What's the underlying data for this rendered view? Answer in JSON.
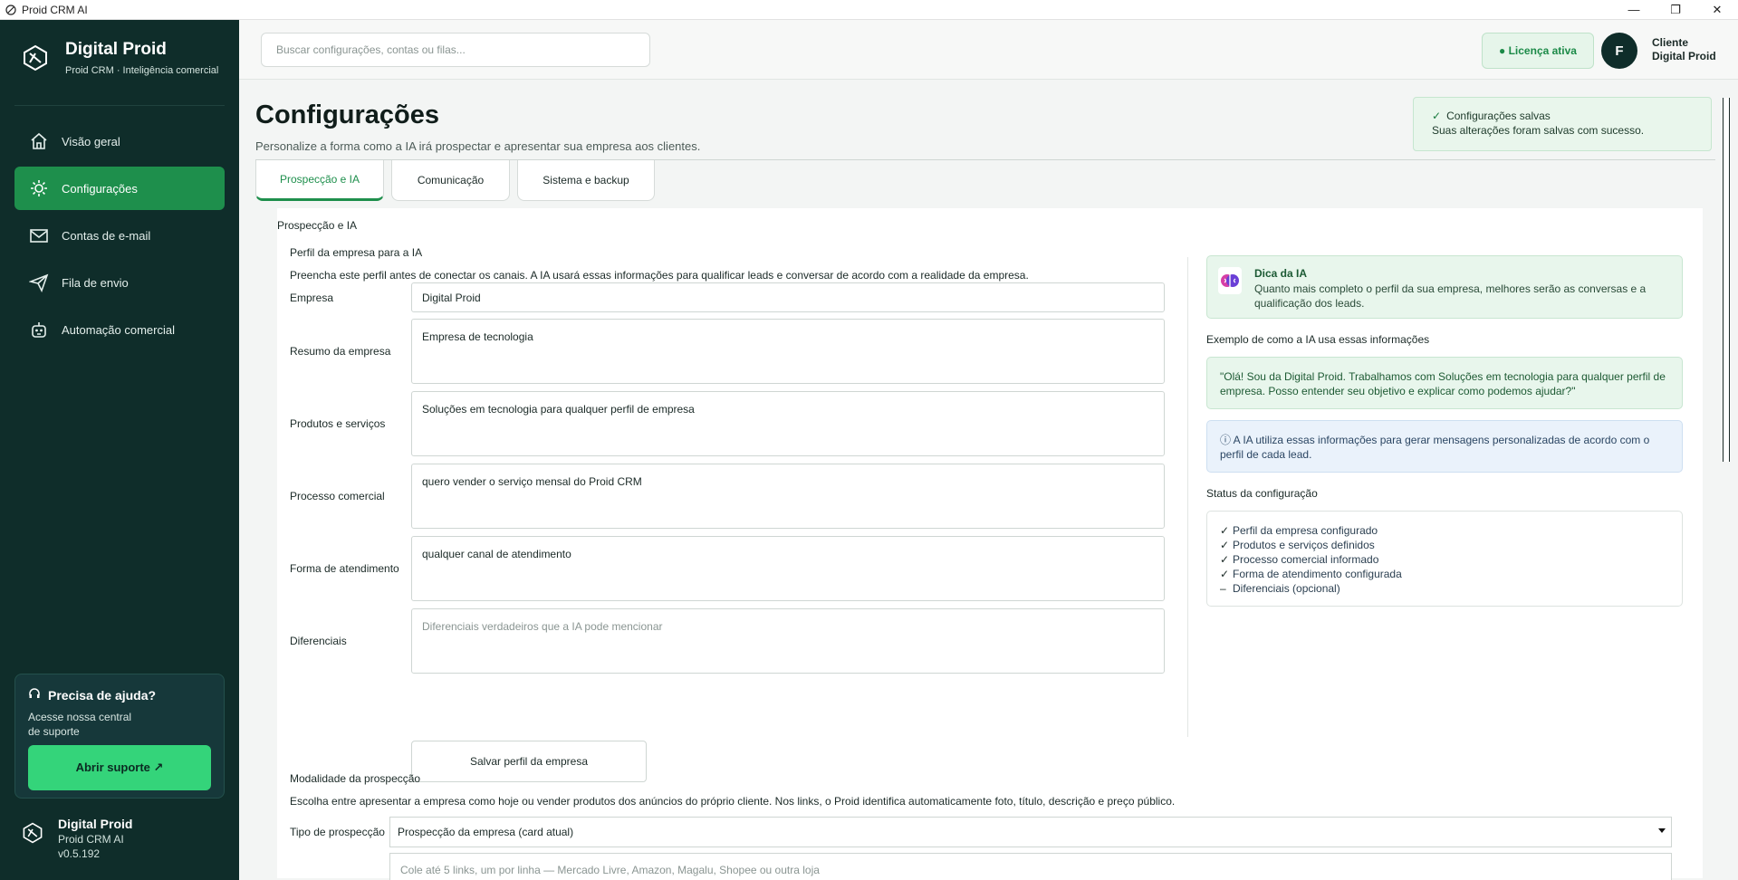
{
  "window": {
    "title": "Proid CRM AI",
    "controls": [
      "—",
      "❐",
      "✕"
    ]
  },
  "brand": {
    "name": "Digital Proid",
    "tagline": "Proid CRM · Inteligência comercial"
  },
  "nav": [
    {
      "label": "Visão geral",
      "icon": "home-icon"
    },
    {
      "label": "Configurações",
      "icon": "gear-icon",
      "active": true
    },
    {
      "label": "Contas de e-mail",
      "icon": "mail-icon"
    },
    {
      "label": "Fila de envio",
      "icon": "send-icon"
    },
    {
      "label": "Automação comercial",
      "icon": "robot-icon"
    }
  ],
  "help": {
    "title": "Precisa de ajuda?",
    "text": "Acesse nossa central de suporte",
    "button": "Abrir suporte ↗"
  },
  "footer": {
    "name": "Digital Proid",
    "product": "Proid CRM AI",
    "version": "v0.5.192"
  },
  "header": {
    "search_placeholder": "Buscar configurações, contas ou filas...",
    "license": "● Licença ativa",
    "avatar_initial": "F",
    "user_line1": "Cliente",
    "user_line2": "Digital Proid"
  },
  "page": {
    "title": "Configurações",
    "subtitle": "Personalize a forma como a IA irá prospectar e apresentar sua empresa aos clientes."
  },
  "toast": {
    "title": "Configurações salvas",
    "message": "Suas alterações foram salvas com sucesso."
  },
  "tabs": [
    {
      "label": "Prospecção e IA",
      "active": true
    },
    {
      "label": "Comunicação"
    },
    {
      "label": "Sistema e backup"
    }
  ],
  "section_label": "Prospecção e IA",
  "profile": {
    "heading": "Perfil da empresa para a IA",
    "description": "Preencha este perfil antes de conectar os canais. A IA usará essas informações para qualificar leads e conversar de acordo com a realidade da empresa.",
    "fields": {
      "empresa": {
        "label": "Empresa",
        "value": "Digital Proid"
      },
      "resumo": {
        "label": "Resumo da empresa",
        "value": "Empresa de tecnologia"
      },
      "produtos": {
        "label": "Produtos e serviços",
        "value": "Soluções em tecnologia para qualquer perfil de empresa"
      },
      "processo": {
        "label": "Processo comercial",
        "value": "quero vender o serviço mensal do Proid CRM"
      },
      "atendimento": {
        "label": "Forma de atendimento",
        "value": "qualquer canal de atendimento"
      },
      "diferenciais": {
        "label": "Diferenciais",
        "placeholder": "Diferenciais verdadeiros que a IA pode mencionar"
      }
    },
    "save_button": "Salvar perfil da empresa"
  },
  "tip": {
    "title": "Dica da IA",
    "text": "Quanto mais completo o perfil da sua empresa, melhores serão as conversas e a qualificação dos leads."
  },
  "example": {
    "heading": "Exemplo de como a IA usa essas informações",
    "quote": "\"Olá! Sou da Digital Proid. Trabalhamos com Soluções em tecnologia para qualquer perfil de empresa. Posso entender seu objetivo e explicar como podemos ajudar?\"",
    "info": "ⓘ  A IA utiliza essas informações para gerar mensagens personalizadas de acordo com o perfil de cada lead."
  },
  "status": {
    "heading": "Status da configuração",
    "items": [
      {
        "mark": "✓",
        "text": "Perfil da empresa configurado"
      },
      {
        "mark": "✓",
        "text": "Produtos e serviços definidos"
      },
      {
        "mark": "✓",
        "text": "Processo comercial informado"
      },
      {
        "mark": "✓",
        "text": "Forma de atendimento configurada"
      },
      {
        "mark": "–",
        "text": "Diferenciais (opcional)"
      }
    ]
  },
  "modality": {
    "heading": "Modalidade da prospecção",
    "description": "Escolha entre apresentar a empresa como hoje ou vender produtos dos anúncios do próprio cliente. Nos links, o Proid identifica automaticamente foto, título, descrição e preço público.",
    "type_label": "Tipo de prospecção",
    "type_value": "Prospecção da empresa (card atual)",
    "links_placeholder": "Cole até 5 links, um por linha — Mercado Livre, Amazon, Magalu, Shopee ou outra loja"
  },
  "colors": {
    "sidebar": "#0f2d2a",
    "accent": "#1e8f4c",
    "help_button": "#34d47a",
    "success_bg": "#e8f6ec",
    "info_bg": "#eaf2fb"
  }
}
